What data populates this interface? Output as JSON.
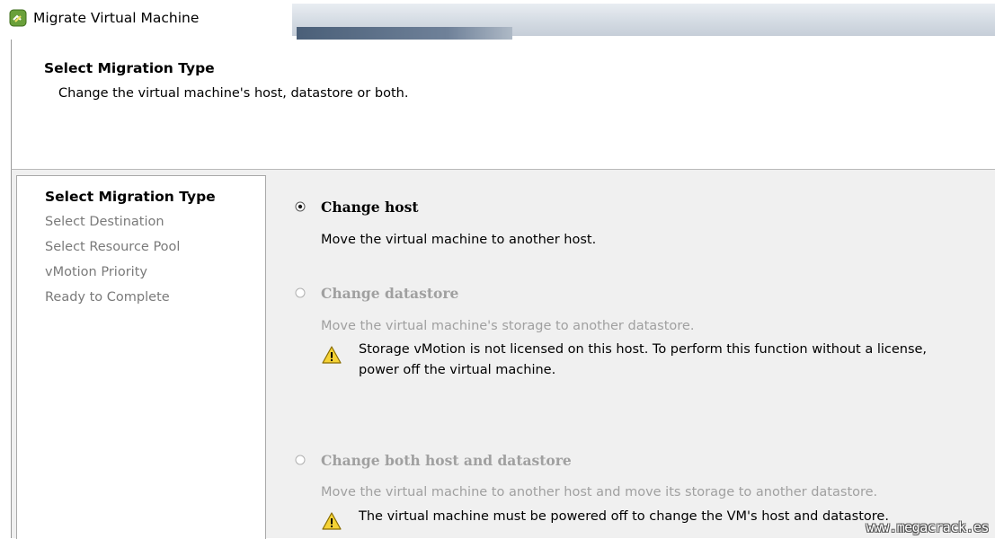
{
  "window": {
    "title": "Migrate Virtual Machine",
    "app_icon": "vsphere-migrate-icon"
  },
  "header": {
    "title": "Select Migration Type",
    "subtitle": "Change the virtual machine's host, datastore or both."
  },
  "steps": [
    {
      "label": "Select Migration Type",
      "active": true
    },
    {
      "label": "Select Destination",
      "active": false
    },
    {
      "label": "Select Resource Pool",
      "active": false
    },
    {
      "label": "vMotion Priority",
      "active": false
    },
    {
      "label": "Ready to Complete",
      "active": false
    }
  ],
  "options": {
    "change_host": {
      "label": "Change host",
      "description": "Move the virtual machine to another host.",
      "selected": true,
      "enabled": true
    },
    "change_datastore": {
      "label": "Change datastore",
      "description": "Move the virtual machine's storage to another datastore.",
      "warning_line1": "Storage vMotion is not licensed on this host. To perform this function without a license,",
      "warning_line2": "power off the virtual machine.",
      "selected": false,
      "enabled": false
    },
    "change_both": {
      "label": "Change both host and datastore",
      "description": "Move the virtual machine to another host and move its storage to another datastore.",
      "warning": "The virtual machine must be powered off to change the VM's host and datastore.",
      "selected": false,
      "enabled": false
    }
  },
  "icons": {
    "warning": "warning-triangle-icon",
    "radio": "radio-button-icon"
  },
  "colors": {
    "disabled_text": "#a0a0a0",
    "panel_bg": "#f0f0f0",
    "warning_fill": "#f5d235"
  },
  "watermark": "www.megacrack.es"
}
